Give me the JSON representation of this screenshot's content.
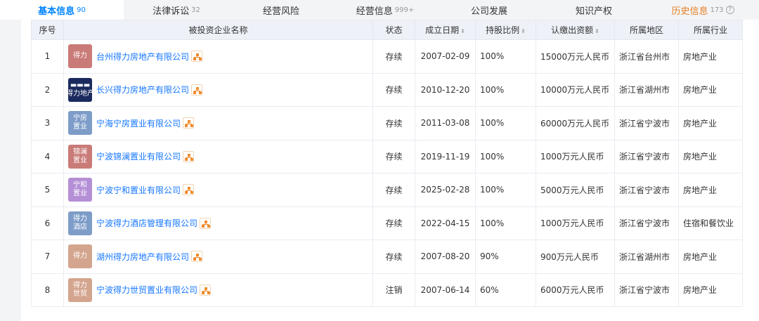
{
  "tabs": [
    {
      "label": "基本信息",
      "count": "90"
    },
    {
      "label": "法律诉讼",
      "count": "32"
    },
    {
      "label": "经营风险",
      "count": ""
    },
    {
      "label": "经营信息",
      "count": "999+"
    },
    {
      "label": "公司发展",
      "count": ""
    },
    {
      "label": "知识产权",
      "count": ""
    },
    {
      "label": "历史信息",
      "count": "173"
    }
  ],
  "help_glyph": "?",
  "table": {
    "headers": [
      "序号",
      "被投资企业名称",
      "状态",
      "成立日期",
      "持股比例",
      "认缴出资额",
      "所属地区",
      "所属行业"
    ],
    "sort_glyph": "⬍",
    "rows": [
      {
        "no": "1",
        "logo": [
          "得力"
        ],
        "logo_color": "#c97b78",
        "name": "台州得力房地产有限公司",
        "status": "存续",
        "date": "2007-02-09",
        "ratio": "100%",
        "capital": "15000万元人民币",
        "region": "浙江省台州市",
        "industry": "房地产业"
      },
      {
        "no": "2",
        "logo": [
          "▬▬▬",
          "得力地产"
        ],
        "logo_color": "#1b2a5e",
        "name": "长兴得力房地产有限公司",
        "status": "存续",
        "date": "2010-12-20",
        "ratio": "100%",
        "capital": "10000万元人民币",
        "region": "浙江省湖州市",
        "industry": "房地产业"
      },
      {
        "no": "3",
        "logo": [
          "宁房",
          "置业"
        ],
        "logo_color": "#7e9cc8",
        "name": "宁海宁房置业有限公司",
        "status": "存续",
        "date": "2011-03-08",
        "ratio": "100%",
        "capital": "60000万元人民币",
        "region": "浙江省宁波市",
        "industry": "房地产业"
      },
      {
        "no": "4",
        "logo": [
          "锦澜",
          "置业"
        ],
        "logo_color": "#c97b78",
        "name": "宁波锦澜置业有限公司",
        "status": "存续",
        "date": "2019-11-19",
        "ratio": "100%",
        "capital": "1000万元人民币",
        "region": "浙江省宁波市",
        "industry": "房地产业"
      },
      {
        "no": "5",
        "logo": [
          "宁和",
          "置业"
        ],
        "logo_color": "#b48fd6",
        "name": "宁波宁和置业有限公司",
        "status": "存续",
        "date": "2025-02-28",
        "ratio": "100%",
        "capital": "5000万元人民币",
        "region": "浙江省宁波市",
        "industry": "房地产业"
      },
      {
        "no": "6",
        "logo": [
          "得力",
          "酒店"
        ],
        "logo_color": "#7e9cc8",
        "name": "宁波得力酒店管理有限公司",
        "status": "存续",
        "date": "2022-04-15",
        "ratio": "100%",
        "capital": "1000万元人民币",
        "region": "浙江省宁波市",
        "industry": "住宿和餐饮业"
      },
      {
        "no": "7",
        "logo": [
          "得力"
        ],
        "logo_color": "#d4a58e",
        "name": "湖州得力房地产有限公司",
        "status": "存续",
        "date": "2007-08-20",
        "ratio": "90%",
        "capital": "900万元人民币",
        "region": "浙江省湖州市",
        "industry": "房地产业"
      },
      {
        "no": "8",
        "logo": [
          "得力",
          "世贸"
        ],
        "logo_color": "#d4a58e",
        "name": "宁波得力世贸置业有限公司",
        "status": "注销",
        "date": "2007-06-14",
        "ratio": "60%",
        "capital": "6000万元人民币",
        "region": "浙江省宁波市",
        "industry": "房地产业"
      }
    ]
  },
  "colors": {
    "accent": "#0084ff",
    "link": "#1677ff",
    "active_status": "#2a9d3a",
    "cancelled_status": "#e5484d",
    "history_tab": "#e67e22"
  }
}
